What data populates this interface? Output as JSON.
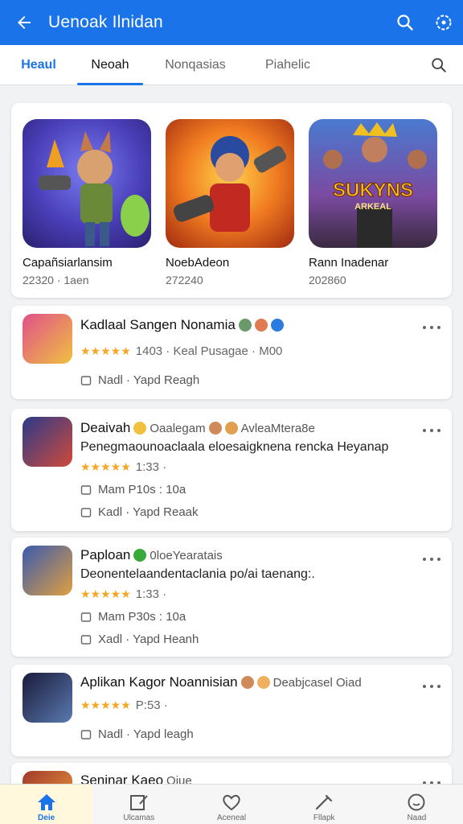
{
  "appbar": {
    "title": "Uenoak Ilnidan",
    "back_icon": "arrow-left-icon",
    "actions": [
      "search-icon",
      "settings-icon"
    ]
  },
  "tabs": {
    "items": [
      "Heaul",
      "Neoah",
      "Nonqasias",
      "Piahelic"
    ],
    "active": 1
  },
  "featured": [
    {
      "name": "Capañsiarlansim",
      "meta": "22320 · 1aen"
    },
    {
      "name": "NoebAdeon",
      "meta": "272240"
    },
    {
      "name": "Rann Inadenar",
      "meta": "202860"
    }
  ],
  "featured_overlay": {
    "line1": "SUKYNS",
    "line2": "ARKEAL"
  },
  "list": [
    {
      "title": "Kadlaal Sangen Nonamia",
      "extra": "",
      "desc": "",
      "rating_stars": 5,
      "rating": "1403 · Keal Pusagae · M00",
      "line3": "",
      "line4": "Nadl · Yapd Reagh"
    },
    {
      "title": "Deaivah",
      "extra": "Oaalegam",
      "extra2": "AvleaMtera8e",
      "desc": "Penegmaounoaclaala eloesaigknena rencka Heyanap",
      "rating_stars": 5,
      "rating": "1:33 ·",
      "line3": "Mam P10s : 10a",
      "line4": "Kadl · Yapd Reaak"
    },
    {
      "title": "Paploan",
      "extra": "0loeYearatais",
      "desc": "Deonentelaandentaclania po/ai taenang:.",
      "rating_stars": 5,
      "rating": "1:33 ·",
      "line3": "Mam P30s : 10a",
      "line4": "Xadl · Yapd Heanh"
    },
    {
      "title": "Aplikan Kagor Noannisian",
      "extra": "Deabjcasel Oiad",
      "desc": "",
      "rating_stars": 5,
      "rating": "P:53 ·",
      "line3": "",
      "line4": "Nadl · Yapd leagh"
    },
    {
      "title": "Seninar Kaeo",
      "extra": "Oiue",
      "desc": ""
    }
  ],
  "stars_glyph": "★★★★★",
  "bottomnav": [
    "Deie",
    "Ulcamas",
    "Aceneal",
    "Fllapk",
    "Naad"
  ],
  "colors": {
    "accent": "#1a73e8",
    "star": "#f5a623"
  }
}
